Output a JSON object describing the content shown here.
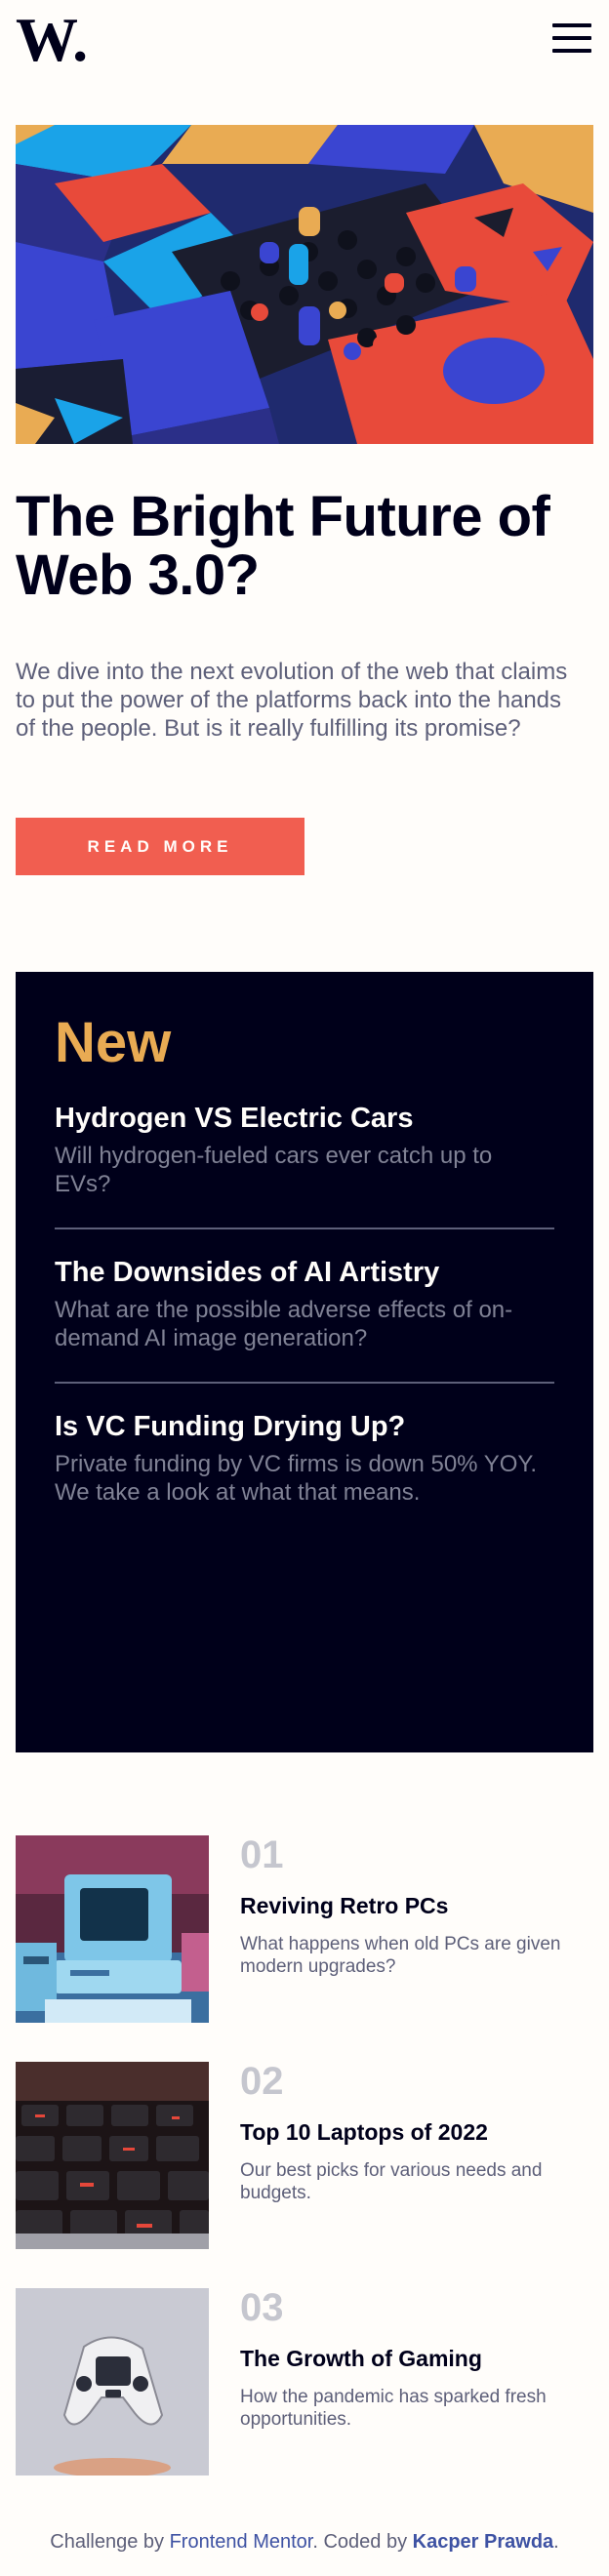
{
  "header": {
    "logo": "W.",
    "menu_icon": "hamburger-menu-icon"
  },
  "hero": {
    "image_icon": "abstract-3d-blocks-illustration",
    "title": "The Bright Future of Web 3.0?",
    "text": "We dive into the next evolution of the web that claims to put the power of the platforms back into the hands of the people. But is it really fulfilling its promise?",
    "button_label": "READ MORE"
  },
  "new_section": {
    "heading": "New",
    "items": [
      {
        "title": "Hydrogen VS Electric Cars",
        "text": "Will hydrogen-fueled cars ever catch up to EVs?"
      },
      {
        "title": "The Downsides of AI Artistry",
        "text": "What are the possible adverse effects of on-demand AI image generation?"
      },
      {
        "title": "Is VC Funding Drying Up?",
        "text": "Private funding by VC firms is down 50% YOY. We take a look at what that means."
      }
    ]
  },
  "articles": [
    {
      "number": "01",
      "title": "Reviving Retro PCs",
      "text": "What happens when old PCs are given modern upgrades?",
      "image_icon": "retro-pc-image"
    },
    {
      "number": "02",
      "title": "Top 10 Laptops of 2022",
      "text": "Our best picks for various needs and budgets.",
      "image_icon": "laptop-keyboard-image"
    },
    {
      "number": "03",
      "title": "The Growth of Gaming",
      "text": "How the pandemic has sparked fresh opportunities.",
      "image_icon": "game-controller-image"
    }
  ],
  "footer": {
    "prefix": "Challenge by ",
    "challenge_link": "Frontend Mentor",
    "middle": ". Coded by ",
    "author_link": "Kacper Prawda",
    "suffix": "."
  },
  "colors": {
    "accent_red": "#f15e50",
    "accent_orange": "#e9ab53",
    "dark_navy": "#00001a",
    "grayish_blue": "#5d5f79",
    "off_white": "#fffdfa",
    "link_blue": "#3e52a3"
  }
}
